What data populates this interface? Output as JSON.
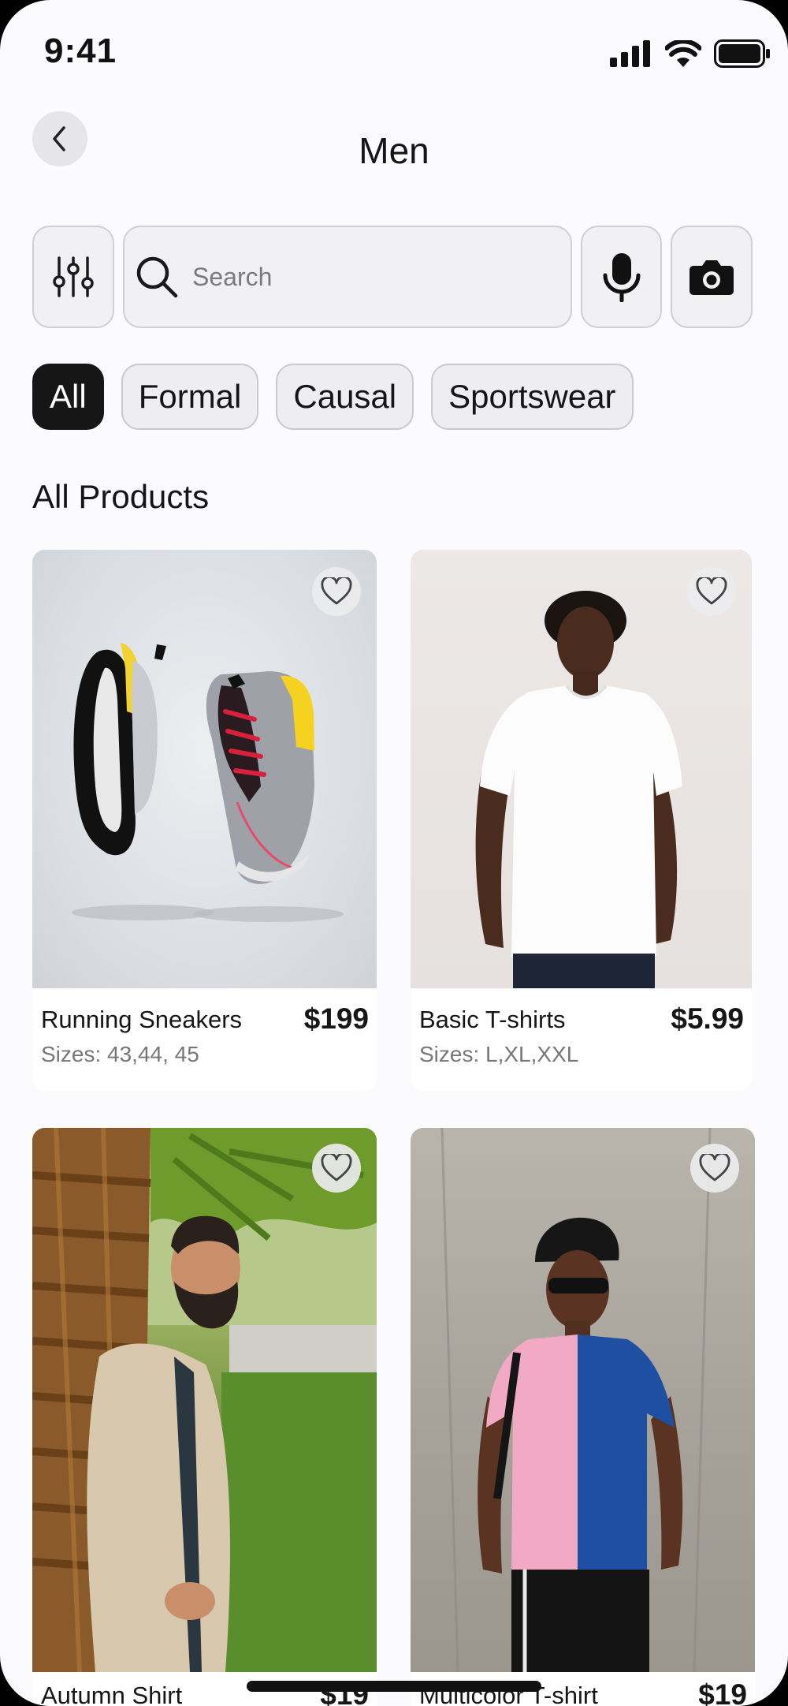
{
  "status": {
    "time": "9:41"
  },
  "header": {
    "title": "Men"
  },
  "search": {
    "placeholder": "Search"
  },
  "chips": [
    "All",
    "Formal",
    "Causal",
    "Sportswear"
  ],
  "section": {
    "title": "All Products"
  },
  "products": [
    {
      "name": "Running Sneakers",
      "price": "$199",
      "sizes": "Sizes: 43,44, 45"
    },
    {
      "name": "Basic T-shirts",
      "price": "$5.99",
      "sizes": "Sizes: L,XL,XXL"
    },
    {
      "name": "Autumn Shirt",
      "price": "$19",
      "sizes": ""
    },
    {
      "name": "Multicolor T-shirt",
      "price": "$19",
      "sizes": ""
    }
  ],
  "icons": {
    "back": "chevron-left-icon",
    "filter": "sliders-icon",
    "search": "search-icon",
    "mic": "microphone-icon",
    "camera": "camera-icon",
    "favorite": "heart-icon"
  }
}
